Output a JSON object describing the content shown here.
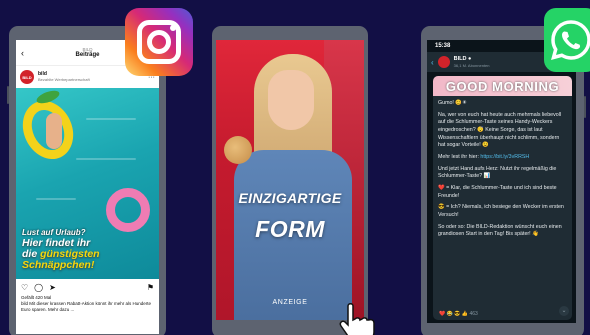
{
  "instagram_post": {
    "top_small": "BILD",
    "top_title": "Beiträge",
    "back_glyph": "‹",
    "avatar_text": "BILD",
    "username": "bild",
    "sub": "Bezahlte Werbepartnerschaft",
    "menu_glyph": "···",
    "caption_line1": "Lust auf Urlaub?",
    "caption_white1": "Hier findet ihr",
    "caption_white2": "die ",
    "caption_yellow": "günstigsten",
    "caption_yellow2": "Schnäppchen!",
    "likes": "Gefällt 420 Mal",
    "text": "bild Mit dieser krassen Rabatt-Aktion könnt ihr mehr als Hunderte Euro sparen. Mehr dazu ..."
  },
  "story_ad": {
    "headline1": "EINZIGARTIGE",
    "headline2": "FORM",
    "ad_label": "ANZEIGE"
  },
  "whatsapp_chat": {
    "time": "15:38",
    "status_icons": "▮▮ ◉",
    "back_glyph": "‹",
    "channel_name": "BILD ●",
    "channel_sub": "36,1 M. Abonnenten",
    "banner": "GOOD MORNING",
    "msg_1": "Gumo! 😊☀",
    "msg_2": "Na, wer von euch hat heute auch mehrmals liebevoll auf die Schlummer-Taste seines Handy-Weckers eingedroschen? 😴 Keine Sorge, das ist laut Wissenschaftlern überhaupt nicht schlimm, sondern hat sogar Vorteile! 😉",
    "msg_3_prefix": "Mehr lest ihr hier: ",
    "msg_3_link": "https://bit.ly/3vRRSH",
    "msg_4": "Und jetzt Hand aufs Herz: Nutzt ihr regelmäßig die Schlummer-Taste? 📊",
    "msg_5": "❤️ = Klar, die Schlummer-Taste und ich sind beste Freunde!",
    "msg_6": "😎 = Ich? Niemals, ich besiege den Wecker im ersten Versuch!",
    "msg_7": "So oder so: Die BILD-Redaktion wünscht euch einen grandiosen Start in den Tag! Bis später! 👋",
    "reactions": "❤️ 😂 😎 👍 463"
  },
  "colors": {
    "background": "#120f45",
    "phone_frame": "#5d6370",
    "story_red": "#d21f34",
    "whatsapp_green": "#25d366",
    "bild_red": "#d2232a"
  },
  "icons": [
    "instagram-logo-icon",
    "whatsapp-logo-icon",
    "pointer-hand-icon",
    "heart-icon",
    "comment-icon",
    "share-icon",
    "bookmark-icon"
  ]
}
